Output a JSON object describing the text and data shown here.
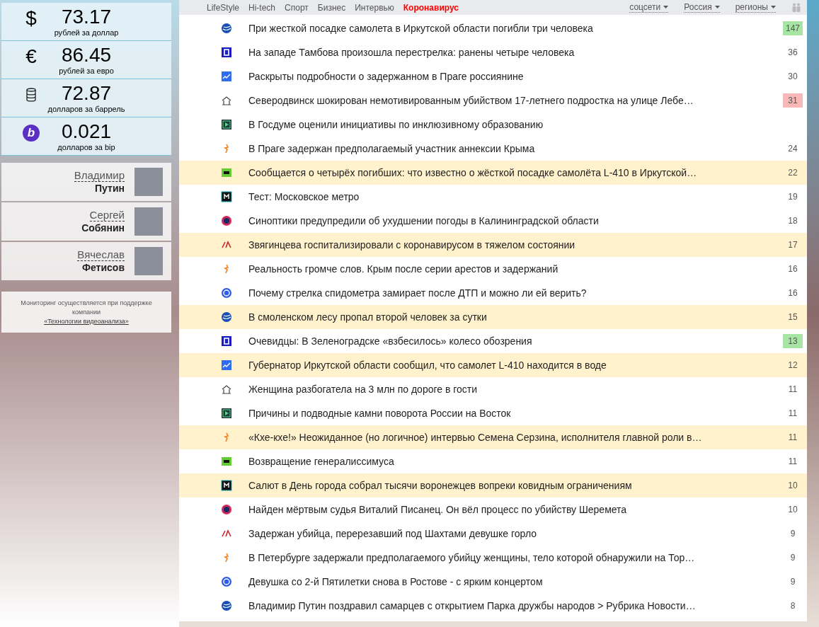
{
  "rates": [
    {
      "symbol": "$",
      "value": "73.17",
      "caption": "рублей за доллар"
    },
    {
      "symbol": "€",
      "value": "86.45",
      "caption": "рублей за евро"
    },
    {
      "value": "72.87",
      "caption": "долларов за баррель"
    },
    {
      "symbol": "b",
      "value": "0.021",
      "caption": "долларов за bip"
    }
  ],
  "people": [
    {
      "first_name": "Владимир",
      "last_name": "Путин"
    },
    {
      "first_name": "Сергей",
      "last_name": "Собянин"
    },
    {
      "first_name": "Вячеслав",
      "last_name": "Фетисов"
    }
  ],
  "sponsor": {
    "text": "Мониторинг осуществляется при поддержке компании",
    "link": "«Технологии видеоанализа»"
  },
  "nav": {
    "tabs": [
      {
        "label": "LifeStyle",
        "selected": false
      },
      {
        "label": "Hi-tech",
        "selected": false
      },
      {
        "label": "Спорт",
        "selected": false
      },
      {
        "label": "Бизнес",
        "selected": false
      },
      {
        "label": "Интервью",
        "selected": false
      },
      {
        "label": "Коронавирус",
        "selected": true
      }
    ],
    "dropdowns": [
      "соцсети",
      "Россия",
      "регионы"
    ]
  },
  "news": [
    {
      "title": "При жесткой посадке самолета в Иркутской области погибли три человека",
      "count": "147",
      "color": "#a8e4a4",
      "highlighted": false
    },
    {
      "title": "На западе Тамбова произошла перестрелка: ранены четыре человека",
      "count": "36",
      "highlighted": false
    },
    {
      "title": "Раскрыты подробности о задержанном в Праге россиянине",
      "count": "30",
      "highlighted": false
    },
    {
      "title": "Северодвинск шокирован немотивированным убийством 17-летнего подростка на улице Лебе…",
      "count": "31",
      "color": "#f8b8b8",
      "highlighted": false
    },
    {
      "title": "В Госдуме оценили инициативы по инклюзивному образованию",
      "highlighted": false
    },
    {
      "title": "В Праге задержан предполагаемый участник аннексии Крыма",
      "count": "24",
      "highlighted": false
    },
    {
      "title": "Сообщается о четырёх погибших: что известно о жёсткой посадке самолёта L-410 в Иркутской…",
      "count": "22",
      "highlighted": true
    },
    {
      "title": "Тест: Московское метро",
      "count": "19",
      "highlighted": false
    },
    {
      "title": "Синоптики предупредили об ухудшении погоды в Калининградской области",
      "count": "18",
      "highlighted": false
    },
    {
      "title": "Звягинцева госпитализировали с коронавирусом в тяжелом состоянии",
      "count": "17",
      "highlighted": true
    },
    {
      "title": "Реальность громче слов. Крым после серии арестов и задержаний",
      "count": "16",
      "highlighted": false
    },
    {
      "title": "Почему стрелка спидометра замирает после ДТП и можно ли ей верить?",
      "count": "16",
      "highlighted": false
    },
    {
      "title": "В смоленском лесу пропал второй человек за сутки",
      "count": "15",
      "highlighted": true
    },
    {
      "title": "Очевидцы: В Зеленоградске «взбесилось» колесо обозрения",
      "count": "13",
      "color": "#a8e4a4",
      "highlighted": false
    },
    {
      "title": "Губернатор Иркутской области сообщил, что самолет L-410 находится в воде",
      "count": "12",
      "highlighted": true
    },
    {
      "title": "Женщина разбогатела на 3 млн по дороге в гости",
      "count": "11",
      "highlighted": false
    },
    {
      "title": "Причины и подводные камни поворота России на Восток",
      "count": "11",
      "highlighted": false
    },
    {
      "title": "«Кхе-кхе!» Неожиданное (но логичное) интервью Семена Серзина, исполнителя главной роли в…",
      "count": "11",
      "highlighted": true
    },
    {
      "title": "Возвращение генералиссимуса",
      "count": "11",
      "highlighted": false
    },
    {
      "title": "Салют в День города собрал тысячи воронежцев вопреки ковидным ограничениям",
      "count": "10",
      "highlighted": true
    },
    {
      "title": "Найден мёртвым судья Виталий Писанец. Он вёл процесс по убийству Шеремета",
      "count": "10",
      "highlighted": false
    },
    {
      "title": "Задержан убийца, перерезавший под Шахтами девушке горло",
      "count": "9",
      "highlighted": false
    },
    {
      "title": "В Петербурге задержали предполагаемого убийцу женщины, тело которой обнаружили на Тор…",
      "count": "9",
      "highlighted": false
    },
    {
      "title": "Девушка со 2-й Пятилетки снова в Ростове - с ярким концертом",
      "count": "9",
      "highlighted": false
    },
    {
      "title": "Владимир Путин поздравил самарцев с открытием Парка дружбы народов > Рубрика Новости…",
      "count": "8",
      "highlighted": false
    }
  ]
}
